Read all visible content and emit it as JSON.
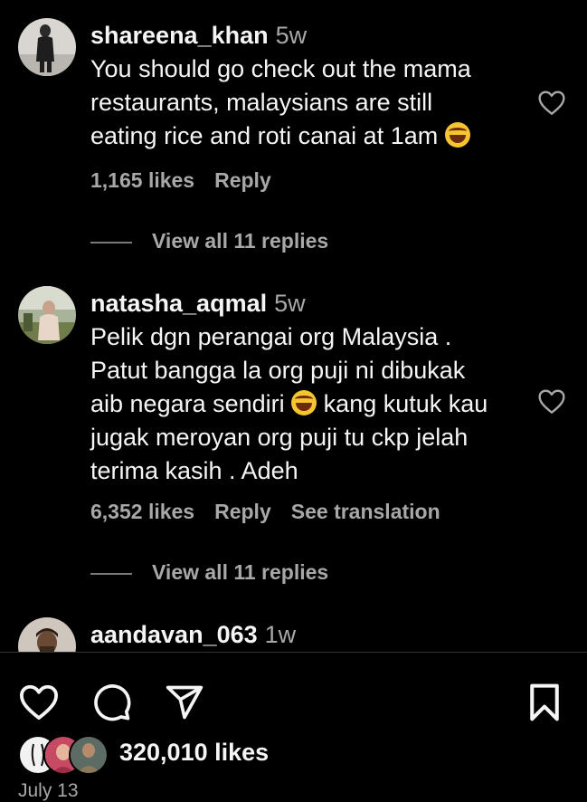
{
  "comments": [
    {
      "username": "shareena_khan",
      "age": "5w",
      "lines": [
        "You should go check out the mama",
        "restaurants, malaysians are still",
        "eating rice and roti canai at 1am"
      ],
      "likes": "1,165 likes",
      "reply": "Reply",
      "view_replies": "View all 11 replies"
    },
    {
      "username": "natasha_aqmal",
      "age": "5w",
      "lines": [
        "Pelik dgn perangai org Malaysia .",
        "Patut bangga la org puji ni dibukak",
        "aib negara sendiri",
        " kang kutuk kau",
        "jugak meroyan org puji tu ckp jelah",
        "terima kasih . Adeh"
      ],
      "likes": "6,352 likes",
      "reply": "Reply",
      "translate": "See translation",
      "view_replies": "View all 11 replies"
    },
    {
      "username": "aandavan_063",
      "age": "1w"
    }
  ],
  "post": {
    "likes": "320,010 likes",
    "date": "July 13"
  },
  "icons": {
    "like": "heart-icon",
    "comment": "comment-bubble-icon",
    "share": "paper-plane-icon",
    "save": "bookmark-icon",
    "emoji": "face-with-tears-of-joy-emoji"
  },
  "colors": {
    "background": "#000000",
    "primary_text": "#f5f5f5",
    "secondary_text": "#a8a8a8"
  }
}
